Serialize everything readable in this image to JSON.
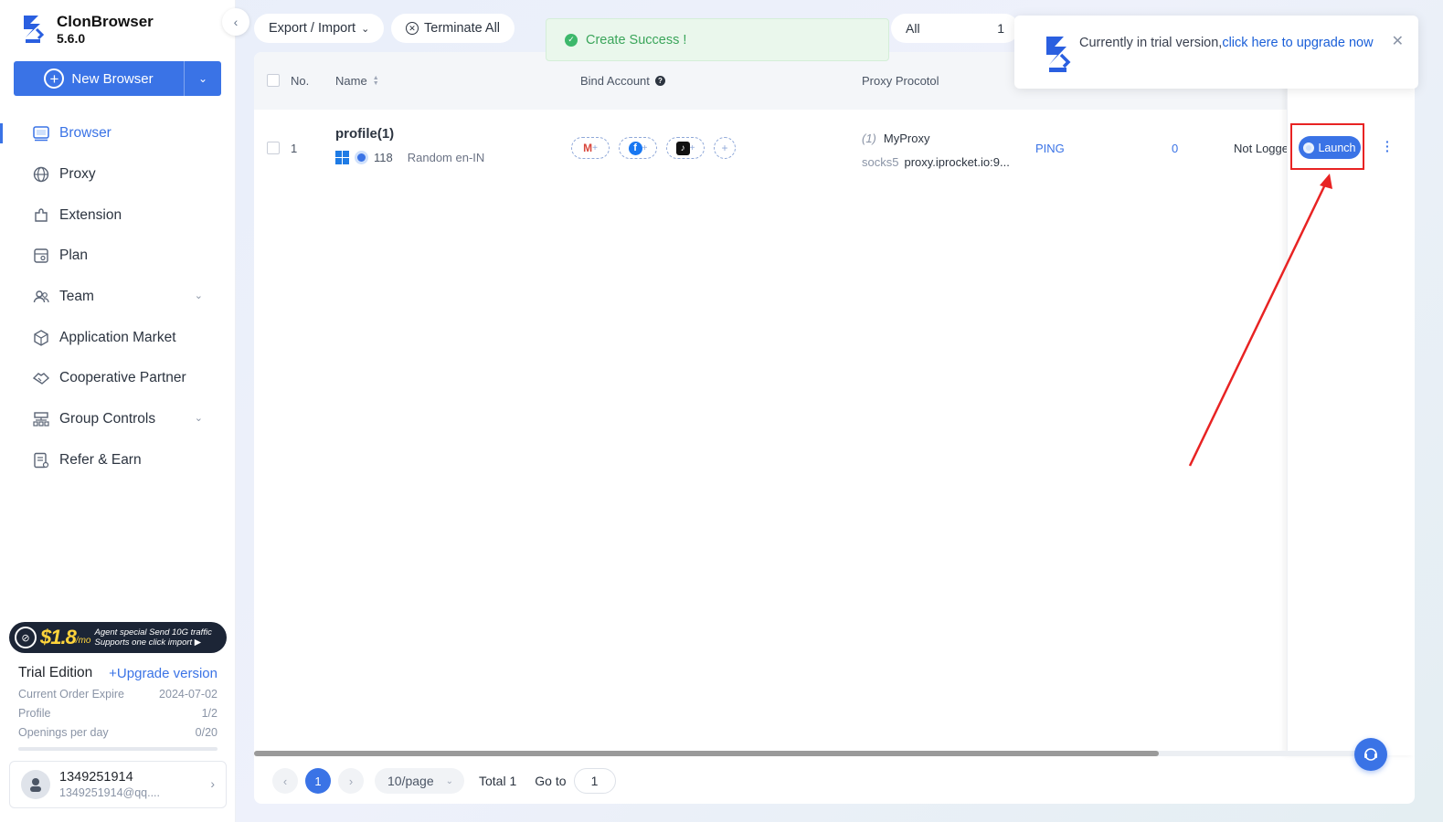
{
  "app": {
    "name": "ClonBrowser",
    "version": "5.6.0"
  },
  "sidebar": {
    "new_browser_label": "New Browser",
    "items": [
      {
        "label": "Browser",
        "icon": "browser-icon",
        "active": true
      },
      {
        "label": "Proxy",
        "icon": "globe-icon"
      },
      {
        "label": "Extension",
        "icon": "puzzle-icon"
      },
      {
        "label": "Plan",
        "icon": "plan-icon"
      },
      {
        "label": "Team",
        "icon": "team-icon",
        "has_caret": true
      },
      {
        "label": "Application Market",
        "icon": "cube-icon"
      },
      {
        "label": "Cooperative Partner",
        "icon": "handshake-icon"
      },
      {
        "label": "Group Controls",
        "icon": "group-icon",
        "has_caret": true
      },
      {
        "label": "Refer & Earn",
        "icon": "refer-icon"
      }
    ],
    "promo": {
      "price": "$1.8",
      "unit": "/mo",
      "line1": "Agent special Send 10G traffic",
      "line2": "Supports one click import ▶"
    },
    "plan": {
      "title": "Trial Edition",
      "upgrade_label": "+Upgrade version",
      "rows": [
        {
          "label": "Current Order Expire",
          "value": "2024-07-02"
        },
        {
          "label": "Profile",
          "value": "1/2"
        },
        {
          "label": "Openings per day",
          "value": "0/20"
        }
      ]
    },
    "user": {
      "name": "1349251914",
      "email": "1349251914@qq...."
    }
  },
  "toolbar": {
    "export_import_label": "Export / Import",
    "terminate_all_label": "Terminate All",
    "filter_label": "All",
    "filter_count": "1"
  },
  "toast": {
    "message": "Create Success !"
  },
  "notification": {
    "text": "Currently in trial version,",
    "link": "click here to upgrade now"
  },
  "table": {
    "headers": {
      "no": "No.",
      "name": "Name",
      "bind_account": "Bind Account",
      "proxy_protocol": "Proxy Procotol"
    },
    "rows": [
      {
        "no": "1",
        "name": "profile(1)",
        "version": "118",
        "fingerprint": "Random en-IN",
        "bind_accounts": [
          "M",
          "f",
          "♪",
          ""
        ],
        "proxy_index": "(1)",
        "proxy_name": "MyProxy",
        "proxy_type": "socks5",
        "proxy_host": "proxy.iprocket.io:9...",
        "ping_label": "PING",
        "count": "0",
        "status": "Not Logge",
        "launch_label": "Launch"
      }
    ]
  },
  "pagination": {
    "current": "1",
    "page_size": "10/page",
    "total": "Total 1",
    "goto_label": "Go to",
    "goto_value": "1"
  },
  "colors": {
    "accent": "#3a73e6",
    "highlight": "#e82323",
    "success": "#3aa55a"
  }
}
